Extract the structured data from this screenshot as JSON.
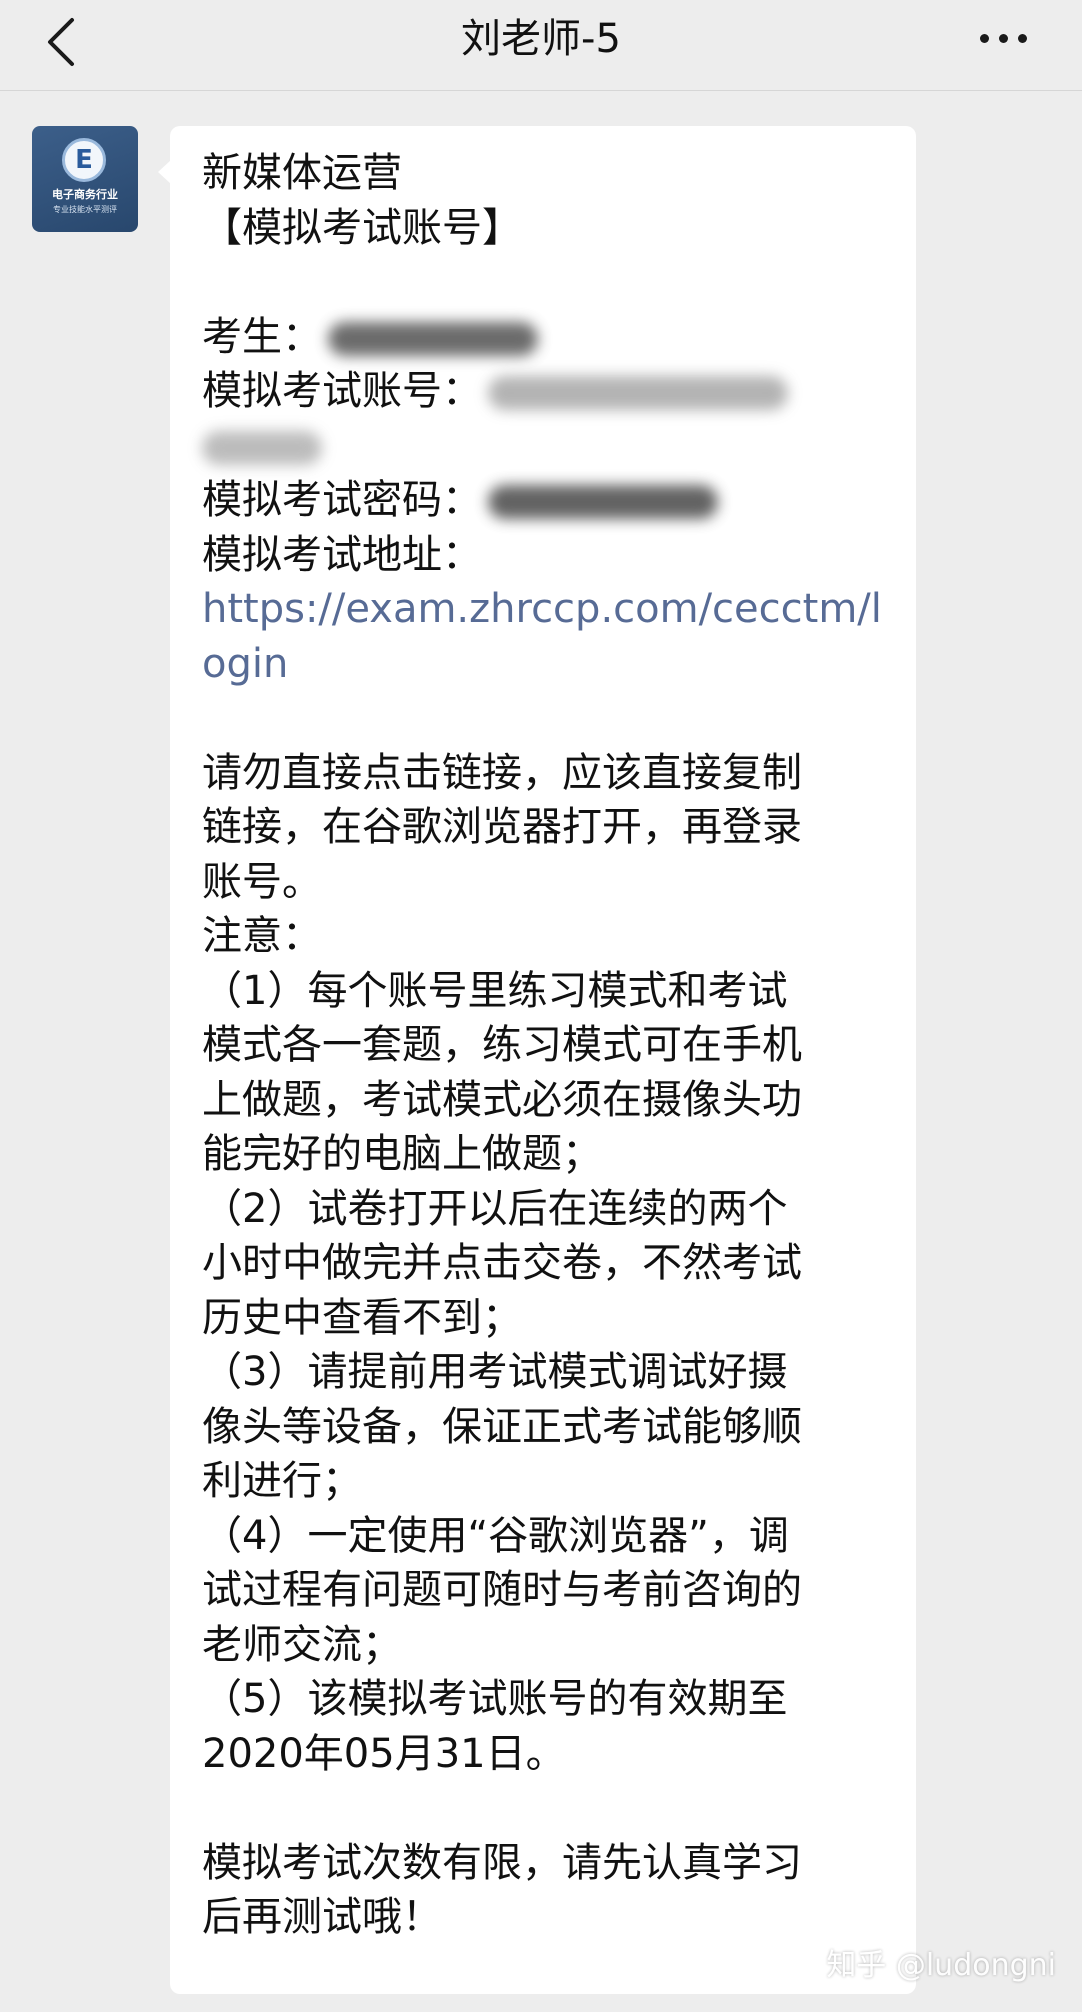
{
  "header": {
    "title": "刘老师-5",
    "back_icon": "chevron-left-icon",
    "more_icon": "more-dots-icon"
  },
  "avatar": {
    "letter": "E",
    "line1": "电子商务行业",
    "line2": "专业技能水平测评",
    "color": "#2f5078"
  },
  "message": {
    "lines": [
      "新媒体运营",
      "【模拟考试账号】",
      "",
      "考生：",
      "模拟考试账号：",
      "",
      "模拟考试密码：",
      "模拟考试地址：",
      "https://exam.zhrccp.com/cecctm/l",
      "ogin",
      "",
      "请勿直接点击链接，应该直接复制",
      "链接，在谷歌浏览器打开，再登录",
      "账号。",
      "注意：",
      "（1）每个账号里练习模式和考试",
      "模式各一套题，练习模式可在手机",
      "上做题，考试模式必须在摄像头功",
      "能完好的电脑上做题；",
      "（2）试卷打开以后在连续的两个",
      "小时中做完并点击交卷，不然考试",
      "历史中查看不到；",
      "（3）请提前用考试模式调试好摄",
      "像头等设备，保证正式考试能够顺",
      "利进行；",
      "（4）一定使用“谷歌浏览器”，调",
      "试过程有问题可随时与考前咨询的",
      "老师交流；",
      "（5）该模拟考试账号的有效期至",
      "2020年05月31日。",
      "",
      "模拟考试次数有限，请先认真学习",
      "后再测试哦！"
    ],
    "link_color": "#576b95"
  },
  "watermark": "知乎 @ludongni"
}
